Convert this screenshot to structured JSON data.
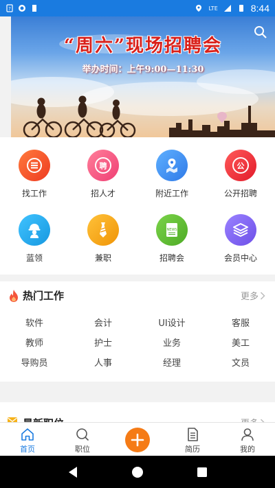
{
  "status_bar": {
    "time": "8:44",
    "network": "LTE"
  },
  "banner": {
    "title": "“周六”现场招聘会",
    "subtitle": "举办时间：上午9:00—11:30"
  },
  "menu": {
    "items": [
      {
        "label": "找工作",
        "icon": "list-icon",
        "color": "#f2562a"
      },
      {
        "label": "招人才",
        "icon": "recruit-badge-icon",
        "color": "#f2467a"
      },
      {
        "label": "附近工作",
        "icon": "map-pin-icon",
        "color": "#3a8ef0"
      },
      {
        "label": "公开招聘",
        "icon": "public-badge-icon",
        "color": "#ec2f3b"
      },
      {
        "label": "蓝领",
        "icon": "worker-helmet-icon",
        "color": "#1ba6e8"
      },
      {
        "label": "兼职",
        "icon": "tie-icon",
        "color": "#f5a413"
      },
      {
        "label": "招聘会",
        "icon": "news-icon",
        "color": "#62c23a"
      },
      {
        "label": "会员中心",
        "icon": "layers-icon",
        "color": "#7a5ef0"
      }
    ]
  },
  "hot_jobs": {
    "title": "热门工作",
    "more": "更多",
    "tags": [
      "软件",
      "会计",
      "UI设计",
      "客服",
      "教师",
      "护士",
      "业务",
      "美工",
      "导购员",
      "人事",
      "经理",
      "文员"
    ]
  },
  "latest": {
    "title": "最新职位",
    "more": "更多"
  },
  "tabbar": {
    "tabs": [
      {
        "label": "首页",
        "icon": "home-icon"
      },
      {
        "label": "职位",
        "icon": "search-icon"
      },
      {
        "label": "",
        "icon": "plus-icon"
      },
      {
        "label": "简历",
        "icon": "document-icon"
      },
      {
        "label": "我的",
        "icon": "person-icon"
      }
    ],
    "active_color": "#1a7be0",
    "publish_color": "#f57b16"
  }
}
